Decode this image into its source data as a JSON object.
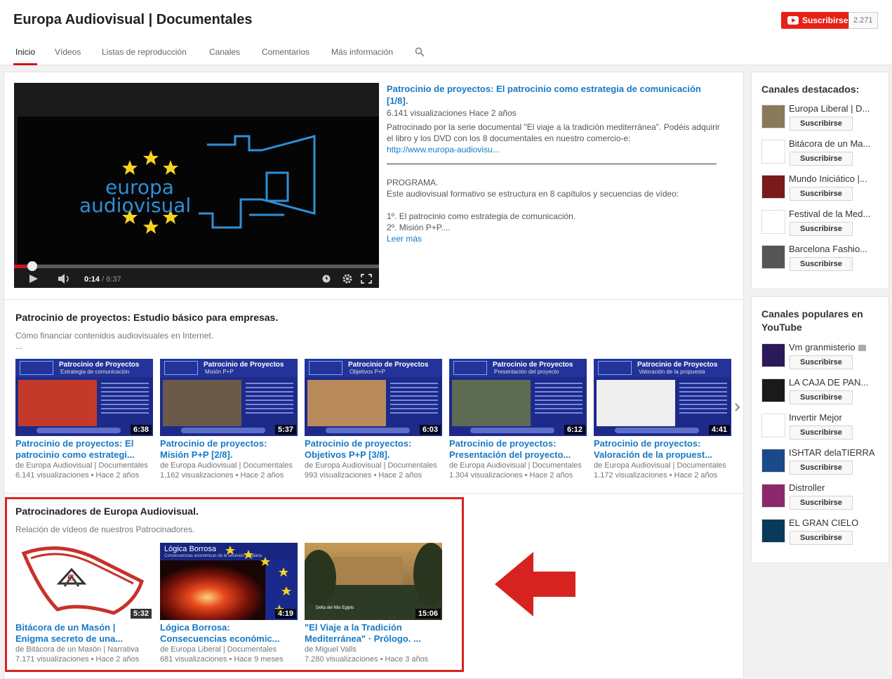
{
  "header": {
    "channel_title": "Europa Audiovisual | Documentales",
    "subscribe_label": "Suscribirse",
    "subscriber_count": "2.271",
    "tabs": [
      "Inicio",
      "Vídeos",
      "Listas de reproducción",
      "Canales",
      "Comentarios",
      "Más información"
    ]
  },
  "player": {
    "current_time": "0:14",
    "duration": "/ 6:37",
    "progress": 0.035,
    "logo_line1": "europa",
    "logo_line2": "audiovisual"
  },
  "featured_video": {
    "title": "Patrocinio de proyectos: El patrocinio como estrategia de comunicación [1/8].",
    "meta": "6.141 visualizaciones  Hace 2 años",
    "description": "Patrocinado por la serie documental \"El viaje a la tradición mediterránea\". Podéis adquirir el libro y los DVD con los 8 documentales en nuestro comercio-e:",
    "link": "http://www.europa-audiovisu...",
    "programa": "PROGRAMA.",
    "programa_desc": "Este audiovisual formativo se estructura en 8 capítulos y secuencias de vídeo:",
    "item1": "1º. El patrocinio como estrategia de comunicación.",
    "item2": "2º. Misión P+P....",
    "read_more": "Leer más"
  },
  "section1": {
    "title": "Patrocinio de proyectos: Estudio básico para empresas.",
    "desc": "Cómo financiar contenidos audiovisuales en Internet.",
    "ellipsis": "...",
    "videos": [
      {
        "thumb_title": "Patrocinio de Proyectos",
        "thumb_sub": "Estrategia de comunicación",
        "duration": "6:38",
        "title1": "Patrocinio de proyectos: El",
        "title2": "patrocinio como estrategi...",
        "by": "de Europa Audiovisual | Documentales",
        "stats": "6.141 visualizaciones • Hace 2 años",
        "photo_color": "#c43a2a"
      },
      {
        "thumb_title": "Patrocinio de Proyectos",
        "thumb_sub": "Misión P+P",
        "duration": "5:37",
        "title1": "Patrocinio de proyectos:",
        "title2": "Misión P+P [2/8].",
        "by": "de Europa Audiovisual | Documentales",
        "stats": "1.162 visualizaciones • Hace 2 años",
        "photo_color": "#6b5a4a"
      },
      {
        "thumb_title": "Patrocinio de Proyectos",
        "thumb_sub": "Objetivos P+P",
        "duration": "6:03",
        "title1": "Patrocinio de proyectos:",
        "title2": "Objetivos P+P [3/8].",
        "by": "de Europa Audiovisual | Documentales",
        "stats": "993 visualizaciones • Hace 2 años",
        "photo_color": "#b98a5c"
      },
      {
        "thumb_title": "Patrocinio de Proyectos",
        "thumb_sub": "Presentación del proyecto",
        "duration": "6:12",
        "title1": "Patrocinio de proyectos:",
        "title2": "Presentación del proyecto...",
        "by": "de Europa Audiovisual | Documentales",
        "stats": "1.304 visualizaciones • Hace 2 años",
        "photo_color": "#5d6b55"
      },
      {
        "thumb_title": "Patrocinio de Proyectos",
        "thumb_sub": "Valoración de la propuesta",
        "duration": "4:41",
        "title1": "Patrocinio de proyectos:",
        "title2": "Valoración de la propuest...",
        "by": "de Europa Audiovisual | Documentales",
        "stats": "1.172 visualizaciones • Hace 2 años",
        "photo_color": "#eeeeee"
      }
    ]
  },
  "section2": {
    "title": "Patrocinadores de Europa Audiovisual.",
    "desc": "Relación de vídeos de nuestros Patrocinadores.",
    "videos": [
      {
        "duration": "5:32",
        "title1": "Bitácora de un Masón |",
        "title2": "Enigma secreto de una...",
        "by": "de Bitácora de un Masón | Narrativa",
        "stats": "7.171 visualizaciones • Hace 2 años"
      },
      {
        "duration": "4:19",
        "title1": "Lógica Borrosa:",
        "title2": "Consecuencias económic...",
        "by": "de Europa Liberal | Documentales",
        "stats": "681 visualizaciones • Hace 9 meses",
        "thumb_title": "Lógica Borrosa",
        "thumb_sub": "Consecuencias económicas de la secesión catalana"
      },
      {
        "duration": "15:06",
        "title1": "\"El Viaje a la Tradición",
        "title2": "Mediterránea\" · Prólogo. ...",
        "by": "de Miguel Valls",
        "stats": "7.280 visualizaciones • Hace 3 años",
        "thumb_caption": "Delta del Nilo Egipto"
      }
    ]
  },
  "sidebar": {
    "featured_title": "Canales destacados:",
    "featured": [
      {
        "name": "Europa Liberal | D...",
        "color": "#8a7a5a"
      },
      {
        "name": "Bitácora de un Ma...",
        "color": "#ffffff"
      },
      {
        "name": "Mundo Iniciático |...",
        "color": "#7a1a1a"
      },
      {
        "name": "Festival de la Med...",
        "color": "#ffffff"
      },
      {
        "name": "Barcelona Fashio...",
        "color": "#555555"
      }
    ],
    "popular_title": "Canales populares en YouTube",
    "popular": [
      {
        "name": "Vm granmisterio",
        "color": "#2a1a5a",
        "verified": true
      },
      {
        "name": "LA CAJA DE PAN...",
        "color": "#1a1a1a"
      },
      {
        "name": "Invertir Mejor",
        "color": "#ffffff"
      },
      {
        "name": "ISHTAR delaTIERRA",
        "color": "#1a4a8a"
      },
      {
        "name": "Distroller",
        "color": "#8a2a6a"
      },
      {
        "name": "EL GRAN CIELO",
        "color": "#0a3a5a"
      }
    ],
    "subscribe_label": "Suscribirse"
  }
}
